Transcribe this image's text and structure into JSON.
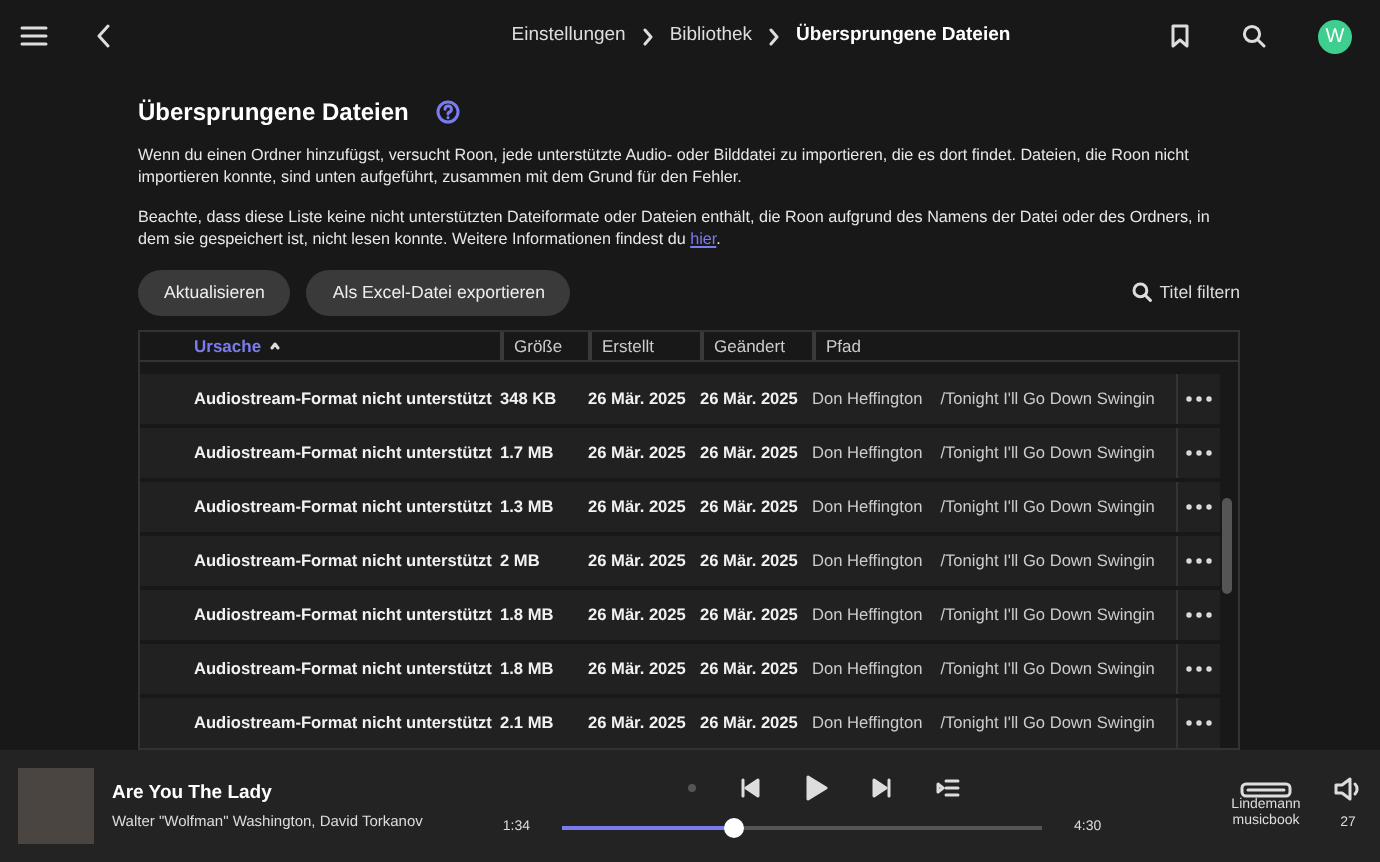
{
  "top_bar": {
    "breadcrumb": [
      {
        "label": "Einstellungen",
        "current": false
      },
      {
        "label": "Bibliothek",
        "current": false
      },
      {
        "label": "Übersprungene Dateien",
        "current": true
      }
    ],
    "avatar": "W"
  },
  "page": {
    "title": "Übersprungene Dateien",
    "paragraphs": [
      {
        "text": "Wenn du einen Ordner hinzufügst, versucht Roon, jede unterstützte Audio- oder Bilddatei zu importieren, die es dort findet. Dateien, die Roon nicht importieren konnte, sind unten aufgeführt, zusammen mit dem Grund für den Fehler."
      },
      {
        "text": "Beachte, dass diese Liste keine nicht unterstützten Dateiformate oder Dateien enthält, die Roon aufgrund des Namens der Datei oder des Ordners, in dem sie gespeichert ist, nicht lesen konnte. Weitere Informationen findest du ",
        "link": "hier",
        "after": "."
      }
    ]
  },
  "buttons": [
    "Aktualisieren",
    "Als Excel-Datei exportieren"
  ],
  "filter": {
    "label": "Titel filtern"
  },
  "table": {
    "columns": [
      {
        "label": "Ursache",
        "sorted": true
      },
      {
        "label": "Größe",
        "sorted": false
      },
      {
        "label": "Erstellt",
        "sorted": false
      },
      {
        "label": "Geändert",
        "sorted": false
      },
      {
        "label": "Pfad",
        "sorted": false
      }
    ],
    "rows": [
      [
        "Audiostream-Format nicht unterstützt",
        "348 KB",
        "26 Mär. 2025",
        "26 Mär. 2025",
        "Don Heffington",
        "/Tonight I'll Go Down Swingin"
      ],
      [
        "Audiostream-Format nicht unterstützt",
        "1.7 MB",
        "26 Mär. 2025",
        "26 Mär. 2025",
        "Don Heffington",
        "/Tonight I'll Go Down Swingin"
      ],
      [
        "Audiostream-Format nicht unterstützt",
        "1.3 MB",
        "26 Mär. 2025",
        "26 Mär. 2025",
        "Don Heffington",
        "/Tonight I'll Go Down Swingin"
      ],
      [
        "Audiostream-Format nicht unterstützt",
        "2 MB",
        "26 Mär. 2025",
        "26 Mär. 2025",
        "Don Heffington",
        "/Tonight I'll Go Down Swingin"
      ],
      [
        "Audiostream-Format nicht unterstützt",
        "1.8 MB",
        "26 Mär. 2025",
        "26 Mär. 2025",
        "Don Heffington",
        "/Tonight I'll Go Down Swingin"
      ],
      [
        "Audiostream-Format nicht unterstützt",
        "1.8 MB",
        "26 Mär. 2025",
        "26 Mär. 2025",
        "Don Heffington",
        "/Tonight I'll Go Down Swingin"
      ],
      [
        "Audiostream-Format nicht unterstützt",
        "2.1 MB",
        "26 Mär. 2025",
        "26 Mär. 2025",
        "Don Heffington",
        "/Tonight I'll Go Down Swingin"
      ]
    ]
  },
  "player": {
    "title": "Are You The Lady",
    "artist": "Walter \"Wolfman\" Washington, David Torkanov",
    "elapsed": "1:34",
    "duration": "4:30",
    "level": 0.36,
    "device": "Lindemann musicbook",
    "volume": "27"
  }
}
